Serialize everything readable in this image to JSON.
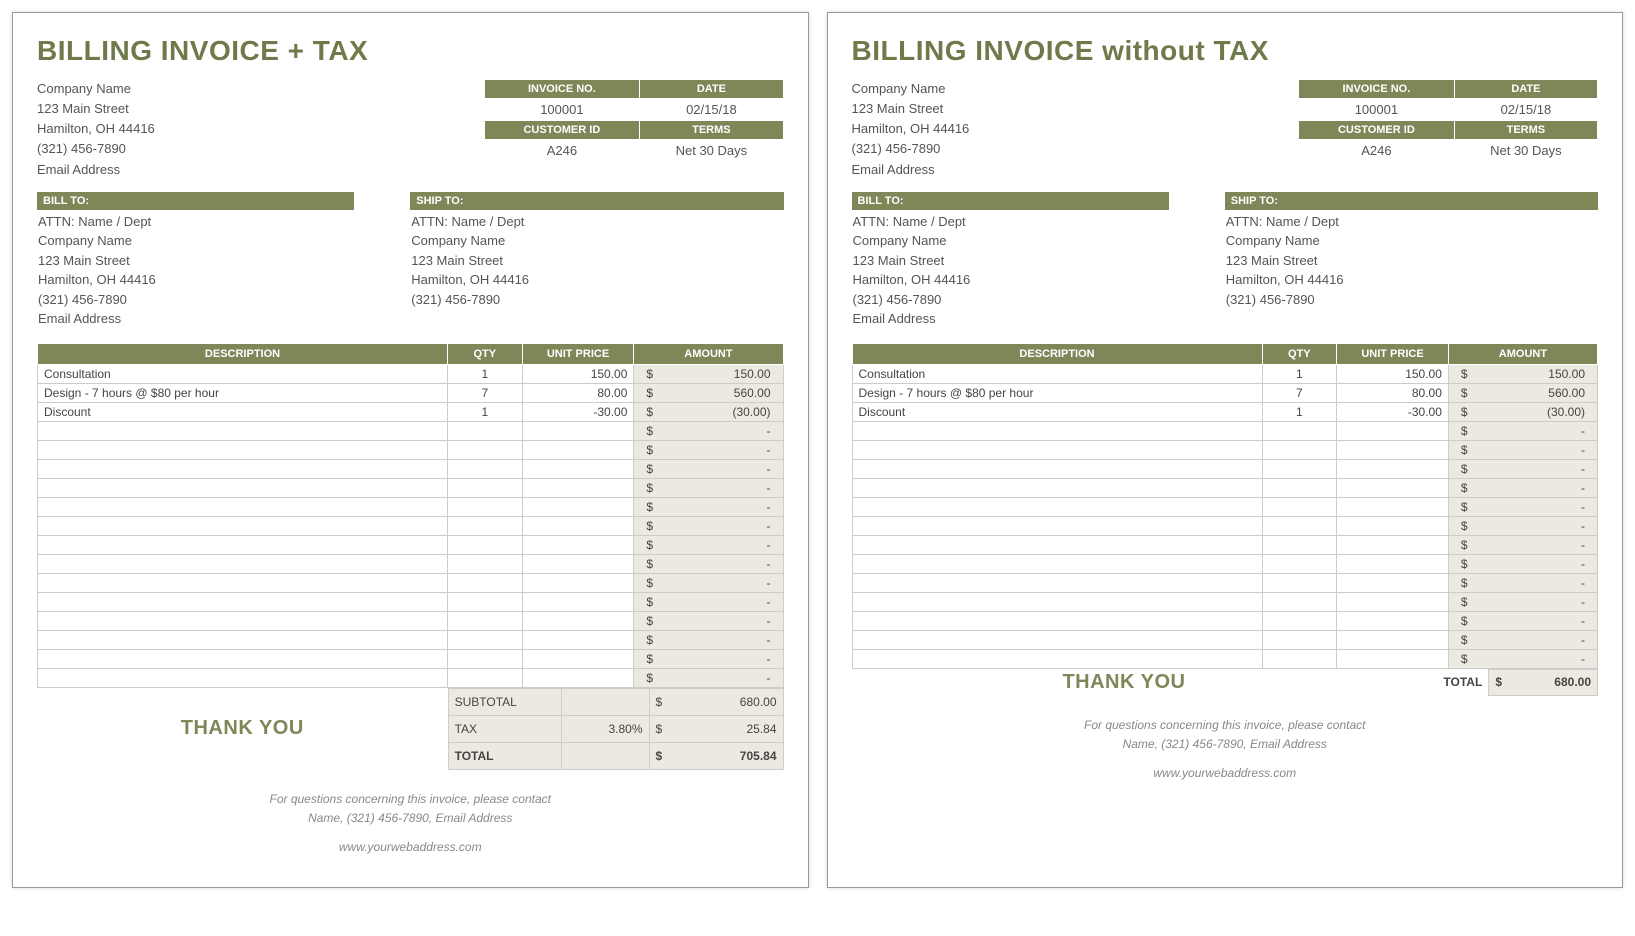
{
  "left": {
    "title": "BILLING INVOICE + TAX",
    "company": [
      "Company Name",
      "123 Main Street",
      "Hamilton, OH  44416",
      "(321) 456-7890",
      "Email Address"
    ],
    "meta_headers1": [
      "INVOICE NO.",
      "DATE"
    ],
    "meta_values1": [
      "100001",
      "02/15/18"
    ],
    "meta_headers2": [
      "CUSTOMER ID",
      "TERMS"
    ],
    "meta_values2": [
      "A246",
      "Net 30 Days"
    ],
    "billto_label": "BILL TO:",
    "shipto_label": "SHIP TO:",
    "billto": [
      "ATTN: Name / Dept",
      "Company Name",
      "123 Main Street",
      "Hamilton, OH  44416",
      "(321) 456-7890",
      "Email Address"
    ],
    "shipto": [
      "ATTN: Name / Dept",
      "Company Name",
      "123 Main Street",
      "Hamilton, OH  44416",
      "(321) 456-7890"
    ],
    "cols": {
      "desc": "DESCRIPTION",
      "qty": "QTY",
      "up": "UNIT PRICE",
      "amt": "AMOUNT"
    },
    "rows": [
      {
        "desc": "Consultation",
        "qty": "1",
        "up": "150.00",
        "amt": "150.00"
      },
      {
        "desc": "Design - 7 hours @ $80 per hour",
        "qty": "7",
        "up": "80.00",
        "amt": "560.00"
      },
      {
        "desc": "Discount",
        "qty": "1",
        "up": "-30.00",
        "amt": "(30.00)"
      }
    ],
    "empty_rows": 14,
    "thanks": "THANK YOU",
    "totals": [
      {
        "label": "SUBTOTAL",
        "mid": "",
        "amt": "680.00",
        "bold": false
      },
      {
        "label": "TAX",
        "mid": "3.80%",
        "amt": "25.84",
        "bold": false
      },
      {
        "label": "TOTAL",
        "mid": "",
        "amt": "705.84",
        "bold": true
      }
    ],
    "footer1": "For questions concerning this invoice, please contact",
    "footer2": "Name, (321) 456-7890, Email Address",
    "footer3": "www.yourwebaddress.com"
  },
  "right": {
    "title": "BILLING INVOICE without TAX",
    "company": [
      "Company Name",
      "123 Main Street",
      "Hamilton, OH  44416",
      "(321) 456-7890",
      "Email Address"
    ],
    "meta_headers1": [
      "INVOICE NO.",
      "DATE"
    ],
    "meta_values1": [
      "100001",
      "02/15/18"
    ],
    "meta_headers2": [
      "CUSTOMER ID",
      "TERMS"
    ],
    "meta_values2": [
      "A246",
      "Net 30 Days"
    ],
    "billto_label": "BILL TO:",
    "shipto_label": "SHIP TO:",
    "billto": [
      "ATTN: Name / Dept",
      "Company Name",
      "123 Main Street",
      "Hamilton, OH  44416",
      "(321) 456-7890",
      "Email Address"
    ],
    "shipto": [
      "ATTN: Name / Dept",
      "Company Name",
      "123 Main Street",
      "Hamilton, OH  44416",
      "(321) 456-7890"
    ],
    "cols": {
      "desc": "DESCRIPTION",
      "qty": "QTY",
      "up": "UNIT PRICE",
      "amt": "AMOUNT"
    },
    "rows": [
      {
        "desc": "Consultation",
        "qty": "1",
        "up": "150.00",
        "amt": "150.00"
      },
      {
        "desc": "Design - 7 hours @ $80 per hour",
        "qty": "7",
        "up": "80.00",
        "amt": "560.00"
      },
      {
        "desc": "Discount",
        "qty": "1",
        "up": "-30.00",
        "amt": "(30.00)"
      }
    ],
    "empty_rows": 13,
    "thanks": "THANK YOU",
    "totals_single": {
      "label": "TOTAL",
      "amt": "680.00"
    },
    "footer1": "For questions concerning this invoice, please contact",
    "footer2": "Name, (321) 456-7890, Email Address",
    "footer3": "www.yourwebaddress.com"
  },
  "currency": "$",
  "dash": "-"
}
